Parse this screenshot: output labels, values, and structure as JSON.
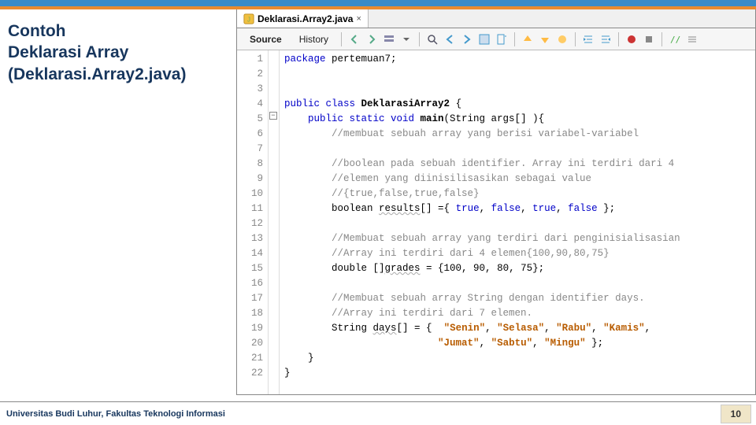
{
  "slide": {
    "title_line1": "Contoh",
    "title_line2": "Deklarasi Array",
    "title_line3": "(Deklarasi.Array2.java)"
  },
  "ide": {
    "tab": {
      "filename": "Deklarasi.Array2.java",
      "close": "×"
    },
    "view_source": "Source",
    "view_history": "History",
    "lines": [
      "1",
      "2",
      "3",
      "4",
      "5",
      "6",
      "7",
      "8",
      "9",
      "10",
      "11",
      "12",
      "13",
      "14",
      "15",
      "16",
      "17",
      "18",
      "19",
      "20",
      "21",
      "22"
    ]
  },
  "code": {
    "l1_a": "package",
    "l1_b": " pertemuan7;",
    "l4_a": "public class ",
    "l4_b": "DeklarasiArray2",
    "l4_c": " {",
    "l5_a": "    public static void ",
    "l5_b": "main",
    "l5_c": "(String args[] ){",
    "l6": "        //membuat sebuah array yang berisi variabel-variabel",
    "l8": "        //boolean pada sebuah identifier. Array ini terdiri dari 4",
    "l9": "        //elemen yang diinisilisasikan sebagai value",
    "l10": "        //{true,false,true,false}",
    "l11_a": "        boolean ",
    "l11_b": "results",
    "l11_c": "[] ={ ",
    "l11_d": "true",
    "l11_e": ", ",
    "l11_f": "false",
    "l11_g": ", ",
    "l11_h": "true",
    "l11_i": ", ",
    "l11_j": "false",
    "l11_k": " };",
    "l13": "        //Membuat sebuah array yang terdiri dari penginisialisasian",
    "l14": "        //Array ini terdiri dari 4 elemen{100,90,80,75}",
    "l15_a": "        double []",
    "l15_b": "grades",
    "l15_c": " = {100, 90, 80, 75};",
    "l17": "        //Membuat sebuah array String dengan identifier days.",
    "l18": "        //Array ini terdiri dari 7 elemen.",
    "l19_a": "        String ",
    "l19_b": "days",
    "l19_c": "[] = {  ",
    "l19_d": "\"Senin\"",
    "l19_e": ", ",
    "l19_f": "\"Selasa\"",
    "l19_g": ", ",
    "l19_h": "\"Rabu\"",
    "l19_i": ", ",
    "l19_j": "\"Kamis\"",
    "l19_k": ",",
    "l20_a": "                          ",
    "l20_b": "\"Jumat\"",
    "l20_c": ", ",
    "l20_d": "\"Sabtu\"",
    "l20_e": ", ",
    "l20_f": "\"Mingu\"",
    "l20_g": " };",
    "l21": "    }",
    "l22": "}"
  },
  "footer": {
    "text": "Universitas Budi Luhur, Fakultas Teknologi Informasi",
    "page": "10"
  }
}
